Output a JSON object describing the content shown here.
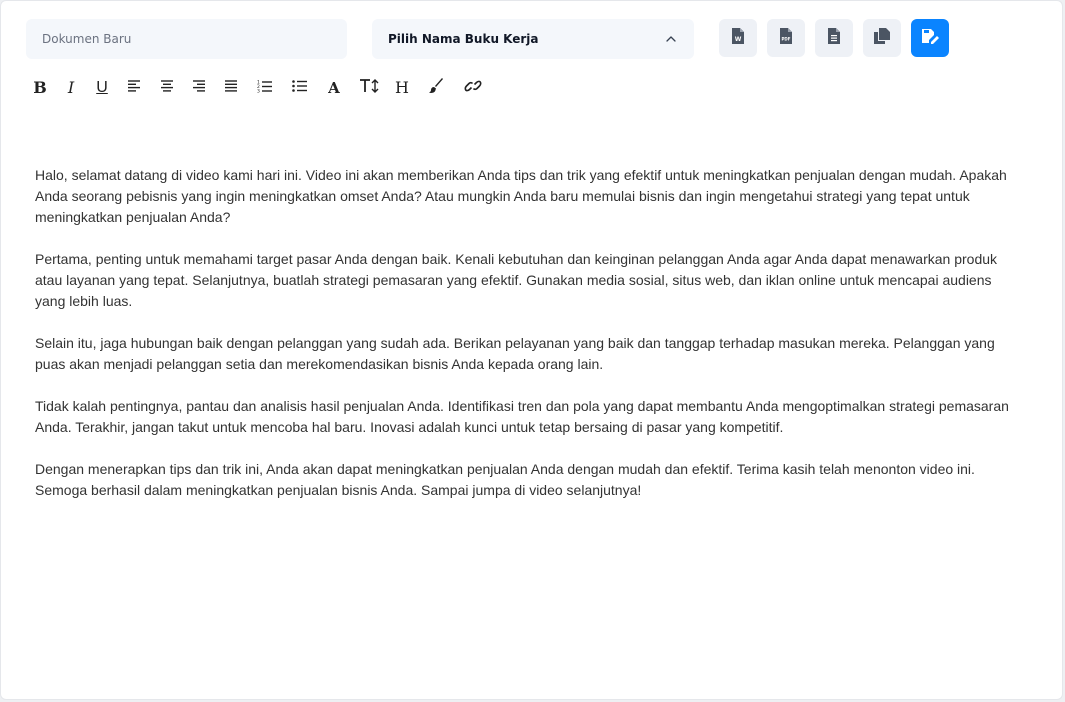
{
  "document": {
    "name_placeholder": "Dokumen Baru",
    "name_value": ""
  },
  "workbook_select": {
    "label": "Pilih Nama Buku Kerja",
    "icon": "chevron-up-icon"
  },
  "actions": [
    {
      "name": "export-word-button",
      "icon": "word-file-icon",
      "glyph": "W"
    },
    {
      "name": "export-pdf-button",
      "icon": "pdf-file-icon",
      "glyph": "PDF"
    },
    {
      "name": "export-text-button",
      "icon": "text-file-icon"
    },
    {
      "name": "copy-button",
      "icon": "copy-icon"
    },
    {
      "name": "save-button",
      "icon": "save-edit-icon"
    }
  ],
  "toolbar": {
    "bold": "B",
    "italic": "I",
    "underline": "U",
    "font_color": "A",
    "heading": "H",
    "tools": [
      "bold-icon",
      "italic-icon",
      "underline-icon",
      "align-left-icon",
      "align-center-icon",
      "align-right-icon",
      "align-justify-icon",
      "ordered-list-icon",
      "unordered-list-icon",
      "font-color-icon",
      "text-size-icon",
      "heading-icon",
      "paint-brush-icon",
      "link-icon"
    ]
  },
  "content": {
    "paragraphs": [
      "Halo, selamat datang di video kami hari ini. Video ini akan memberikan Anda tips dan trik yang efektif untuk meningkatkan penjualan dengan mudah. Apakah Anda seorang pebisnis yang ingin meningkatkan omset Anda? Atau mungkin Anda baru memulai bisnis dan ingin mengetahui strategi yang tepat untuk meningkatkan penjualan Anda?",
      "Pertama, penting untuk memahami target pasar Anda dengan baik. Kenali kebutuhan dan keinginan pelanggan Anda agar Anda dapat menawarkan produk atau layanan yang tepat. Selanjutnya, buatlah strategi pemasaran yang efektif. Gunakan media sosial, situs web, dan iklan online untuk mencapai audiens yang lebih luas.",
      "Selain itu, jaga hubungan baik dengan pelanggan yang sudah ada. Berikan pelayanan yang baik dan tanggap terhadap masukan mereka. Pelanggan yang puas akan menjadi pelanggan setia dan merekomendasikan bisnis Anda kepada orang lain.",
      "Tidak kalah pentingnya, pantau dan analisis hasil penjualan Anda. Identifikasi tren dan pola yang dapat membantu Anda mengoptimalkan strategi pemasaran Anda. Terakhir, jangan takut untuk mencoba hal baru. Inovasi adalah kunci untuk tetap bersaing di pasar yang kompetitif.",
      "Dengan menerapkan tips dan trik ini, Anda akan dapat meningkatkan penjualan Anda dengan mudah dan efektif. Terima kasih telah menonton video ini. Semoga berhasil dalam meningkatkan penjualan bisnis Anda. Sampai jumpa di video selanjutnya!"
    ]
  },
  "colors": {
    "primary": "#0a84ff",
    "field_bg": "#f4f7fb",
    "icon": "#4b5563",
    "text": "#333333"
  }
}
